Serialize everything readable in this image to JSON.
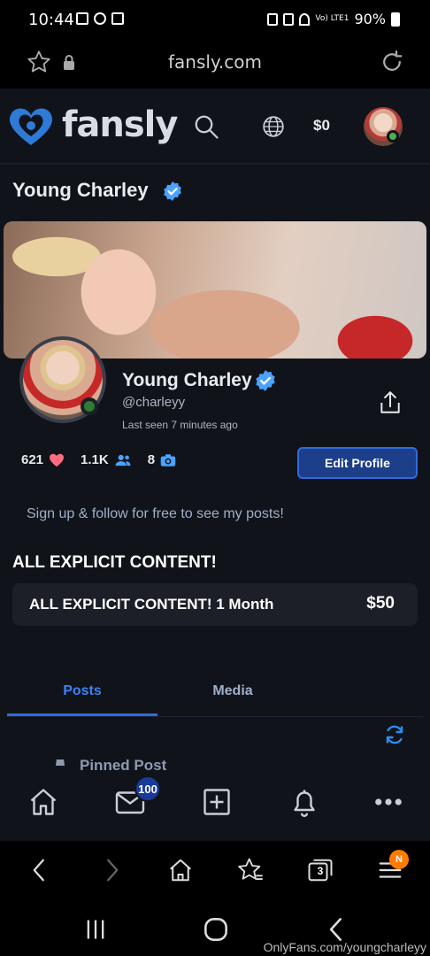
{
  "status_bar": {
    "time": "10:44",
    "network": "Vo) LTE1",
    "battery": "90%"
  },
  "browser": {
    "url": "fansly.com",
    "tab_count": "3",
    "menu_badge": "N"
  },
  "site_header": {
    "logo_text": "fansly",
    "balance": "$0"
  },
  "profile": {
    "title": "Young Charley",
    "display_name": "Young Charley",
    "username": "@charleyy",
    "last_seen": "Last seen 7 minutes ago",
    "stats": {
      "likes": "621",
      "followers": "1.1K",
      "media": "8"
    },
    "edit_button": "Edit Profile",
    "signup_text": "Sign up & follow for free to see my posts!"
  },
  "subscription": {
    "heading": "ALL EXPLICIT CONTENT!",
    "tier_name": "ALL EXPLICIT CONTENT! 1 Month",
    "tier_price": "$50"
  },
  "tabs": [
    {
      "label": "Posts",
      "active": true
    },
    {
      "label": "Media",
      "active": false
    }
  ],
  "pinned_label": "Pinned Post",
  "bottom_nav": {
    "messages_badge": "100"
  },
  "watermark": "OnlyFans.com/youngcharleyy",
  "colors": {
    "accent": "#2f6be0",
    "background": "#10131a",
    "verified": "#4aa3ff"
  }
}
